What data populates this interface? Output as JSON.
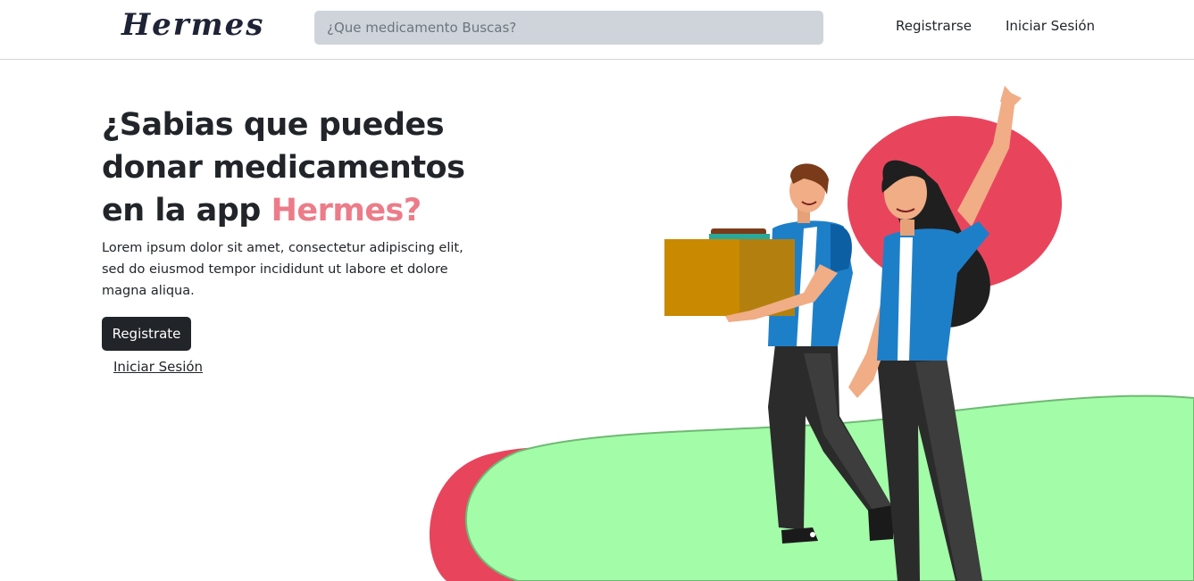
{
  "navbar": {
    "logo": "Hermes",
    "search_placeholder": "¿Que medicamento Buscas?",
    "register_label": "Registrarse",
    "login_label": "Iniciar Sesión"
  },
  "hero": {
    "title_line1": "¿Sabias que puedes",
    "title_line2": "donar medicamentos",
    "title_line3_prefix": "en la app ",
    "title_accent": "Hermes?",
    "description": "Lorem ipsum dolor sit amet, consectetur adipiscing elit, sed do eiusmod tempor incididunt ut labore et dolore magna aliqua.",
    "register_button": "Registrate",
    "login_link": "Iniciar Sesión"
  },
  "colors": {
    "accent": "#ec7c89",
    "dark": "#212529",
    "blob_red": "#e8455d",
    "blob_green": "#a3fca8",
    "shirt_blue": "#1e7fc9"
  }
}
